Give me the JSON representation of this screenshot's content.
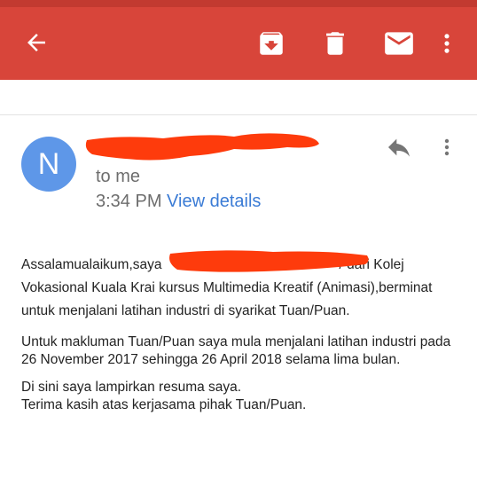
{
  "colors": {
    "appbar": "#d8453a",
    "avatar": "#5e97e8",
    "link": "#3a7bd5",
    "redaction": "#fe3b0c"
  },
  "toolbar": {
    "icons": [
      "back-arrow-icon",
      "archive-icon",
      "delete-icon",
      "mail-icon",
      "more-vert-icon"
    ]
  },
  "message": {
    "avatar_letter": "N",
    "recipient": "to me",
    "time": "3:34 PM",
    "view_details": "View details",
    "header_icons": [
      "reply-icon",
      "more-vert-icon"
    ]
  },
  "body": {
    "p1_before": "Assalamualaikum,saya",
    "p1_after": "/ dari Kolej Vokasional Kuala Krai kursus Multimedia Kreatif (Animasi),berminat untuk menjalani latihan industri di syarikat Tuan/Puan.",
    "p2": "Untuk makluman Tuan/Puan saya mula menjalani latihan industri pada 26 November 2017 sehingga 26 April 2018 selama lima bulan.",
    "p3_line1": "Di sini saya lampirkan resuma saya.",
    "p3_line2": "Terima kasih atas kerjasama pihak Tuan/Puan."
  }
}
